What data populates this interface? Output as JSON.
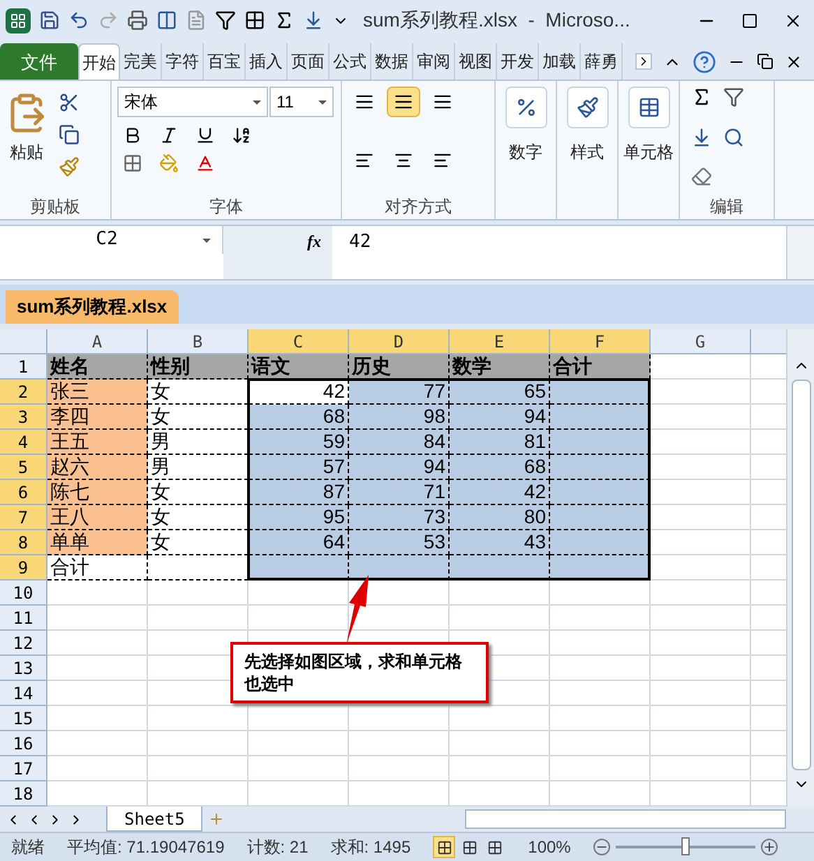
{
  "window": {
    "title": "sum系列教程.xlsx  -  Microso..."
  },
  "ribbon_tabs": [
    {
      "label": "文件",
      "kind": "file",
      "selected": false
    },
    {
      "label": "开始",
      "kind": "tab",
      "selected": true
    },
    {
      "label": "完美",
      "kind": "tab",
      "selected": false
    },
    {
      "label": "字符",
      "kind": "tab",
      "selected": false
    },
    {
      "label": "百宝",
      "kind": "tab",
      "selected": false
    },
    {
      "label": "插入",
      "kind": "tab",
      "selected": false
    },
    {
      "label": "页面",
      "kind": "tab",
      "selected": false
    },
    {
      "label": "公式",
      "kind": "tab",
      "selected": false
    },
    {
      "label": "数据",
      "kind": "tab",
      "selected": false
    },
    {
      "label": "审阅",
      "kind": "tab",
      "selected": false
    },
    {
      "label": "视图",
      "kind": "tab",
      "selected": false
    },
    {
      "label": "开发",
      "kind": "tab",
      "selected": false
    },
    {
      "label": "加载",
      "kind": "tab",
      "selected": false
    },
    {
      "label": "薛勇",
      "kind": "tab",
      "selected": false
    }
  ],
  "ribbon_groups": [
    {
      "label": "剪贴板",
      "kind": "clipboard",
      "button": "粘贴"
    },
    {
      "label": "字体",
      "kind": "font",
      "font": "宋体",
      "size": "11"
    },
    {
      "label": "对齐方式",
      "kind": "align",
      "align_buttons": [
        {
          "selected": false
        },
        {
          "selected": true
        },
        {
          "selected": false
        },
        {
          "selected": false
        },
        {
          "selected": false
        },
        {
          "selected": false
        }
      ]
    },
    {
      "kind": "big",
      "button": "数字"
    },
    {
      "kind": "big",
      "button": "样式"
    },
    {
      "kind": "big",
      "button": "单元格"
    },
    {
      "label": "编辑",
      "kind": "edit"
    }
  ],
  "formula_bar": {
    "name_box": "C2",
    "function_label": "fx",
    "value": "42"
  },
  "workbook_tab": {
    "label": "sum系列教程.xlsx"
  },
  "columns": [
    {
      "label": "A",
      "kind": "text",
      "selected": false
    },
    {
      "label": "B",
      "kind": "text",
      "selected": false
    },
    {
      "label": "C",
      "kind": "number",
      "selected": true
    },
    {
      "label": "D",
      "kind": "number",
      "selected": true
    },
    {
      "label": "E",
      "kind": "number",
      "selected": true
    },
    {
      "label": "F",
      "kind": "number",
      "selected": true
    },
    {
      "label": "G",
      "selected": false
    }
  ],
  "rows": [
    {
      "number": "1",
      "kind": "header",
      "selected": false,
      "cells": [
        {
          "text": "姓名"
        },
        {
          "text": "性别"
        },
        {
          "text": "语文"
        },
        {
          "text": "历史"
        },
        {
          "text": "数学"
        },
        {
          "text": "合计"
        }
      ]
    },
    {
      "number": "2",
      "kind": "data",
      "selected": true,
      "cells": [
        {
          "text": "张三"
        },
        {
          "text": "女"
        },
        {
          "text": "42",
          "active": true
        },
        {
          "text": "77"
        },
        {
          "text": "65"
        },
        {
          "text": ""
        }
      ]
    },
    {
      "number": "3",
      "kind": "data",
      "selected": true,
      "cells": [
        {
          "text": "李四"
        },
        {
          "text": "女"
        },
        {
          "text": "68"
        },
        {
          "text": "98"
        },
        {
          "text": "94"
        },
        {
          "text": ""
        }
      ]
    },
    {
      "number": "4",
      "kind": "data",
      "selected": true,
      "cells": [
        {
          "text": "王五"
        },
        {
          "text": "男"
        },
        {
          "text": "59"
        },
        {
          "text": "84"
        },
        {
          "text": "81"
        },
        {
          "text": ""
        }
      ]
    },
    {
      "number": "5",
      "kind": "data",
      "selected": true,
      "cells": [
        {
          "text": "赵六"
        },
        {
          "text": "男"
        },
        {
          "text": "57"
        },
        {
          "text": "94"
        },
        {
          "text": "68"
        },
        {
          "text": ""
        }
      ]
    },
    {
      "number": "6",
      "kind": "data",
      "selected": true,
      "cells": [
        {
          "text": "陈七"
        },
        {
          "text": "女"
        },
        {
          "text": "87"
        },
        {
          "text": "71"
        },
        {
          "text": "42"
        },
        {
          "text": ""
        }
      ]
    },
    {
      "number": "7",
      "kind": "data",
      "selected": true,
      "cells": [
        {
          "text": "王八"
        },
        {
          "text": "女"
        },
        {
          "text": "95"
        },
        {
          "text": "73"
        },
        {
          "text": "80"
        },
        {
          "text": ""
        }
      ]
    },
    {
      "number": "8",
      "kind": "data",
      "selected": true,
      "cells": [
        {
          "text": "单单"
        },
        {
          "text": "女"
        },
        {
          "text": "64"
        },
        {
          "text": "53"
        },
        {
          "text": "43"
        },
        {
          "text": ""
        }
      ]
    },
    {
      "number": "9",
      "kind": "total",
      "selected": true,
      "cells": [
        {
          "text": "合计"
        },
        {
          "text": ""
        },
        {
          "text": ""
        },
        {
          "text": ""
        },
        {
          "text": ""
        },
        {
          "text": ""
        }
      ]
    },
    {
      "number": "10",
      "selected": false
    },
    {
      "number": "11",
      "selected": false
    },
    {
      "number": "12",
      "selected": false
    },
    {
      "number": "13",
      "selected": false
    },
    {
      "number": "14",
      "selected": false
    },
    {
      "number": "15",
      "selected": false
    },
    {
      "number": "16",
      "selected": false
    },
    {
      "number": "17",
      "selected": false
    },
    {
      "number": "18",
      "selected": false
    }
  ],
  "callout": {
    "text": "先选择如图区域，求和单元格也选中"
  },
  "sheet_tabs": [
    {
      "label": "Sheet5",
      "selected": true
    }
  ],
  "status_bar": {
    "mode": "就绪",
    "average": "平均值: 71.19047619",
    "count": "计数: 21",
    "sum": "求和: 1495",
    "views": [
      {
        "selected": true
      },
      {
        "selected": false
      },
      {
        "selected": false
      }
    ],
    "zoom": "100%",
    "zoom_level": {
      "level": 0.5
    }
  }
}
